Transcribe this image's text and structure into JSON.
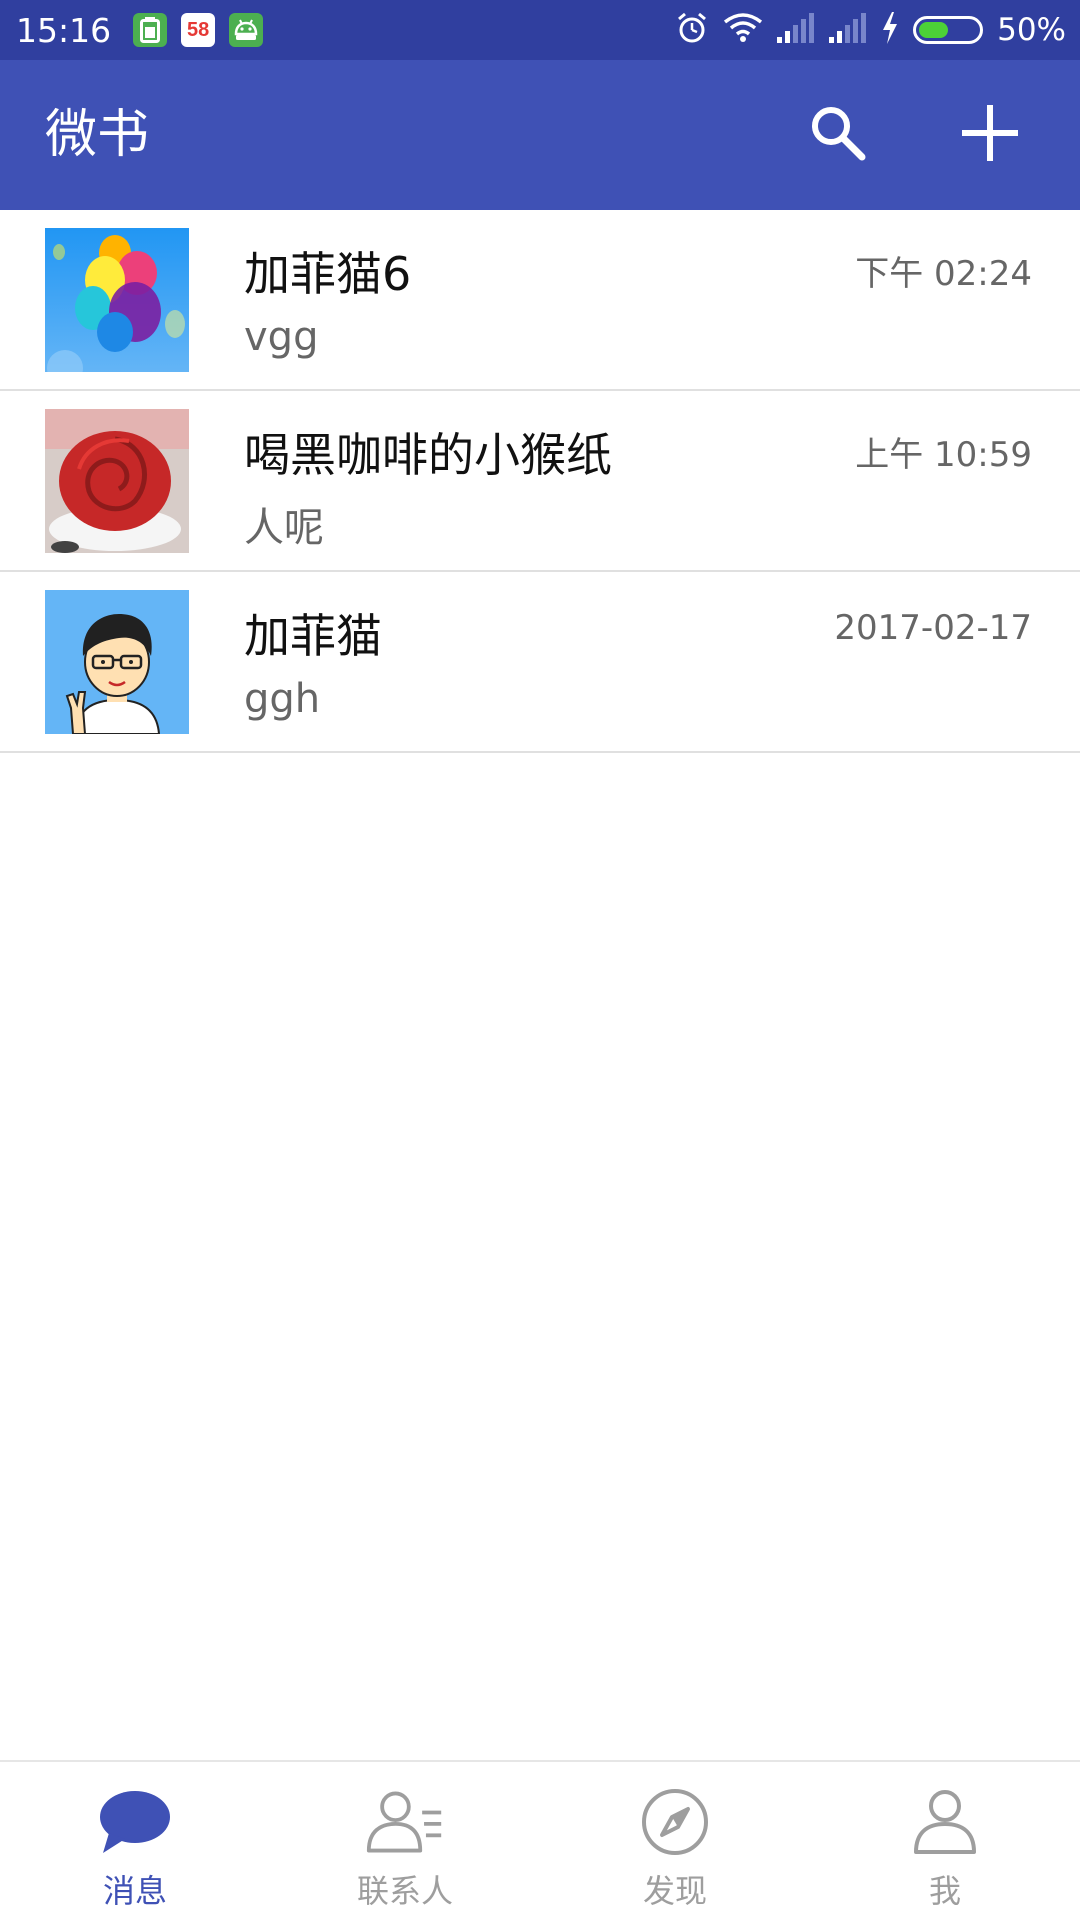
{
  "status_bar": {
    "time": "15:16",
    "battery_percent": "50%",
    "battery_level": 0.5,
    "notification_icons": [
      "battery-app-icon",
      "58-app-icon",
      "android-app-icon"
    ],
    "system_icons": [
      "alarm-icon",
      "wifi-icon",
      "signal-icon",
      "signal-icon",
      "charging-icon",
      "battery-icon"
    ],
    "app_58_label": "58"
  },
  "app_bar": {
    "title": "微书",
    "actions": [
      "search-icon",
      "add-icon"
    ]
  },
  "conversations": [
    {
      "name": "加菲猫6",
      "preview": "vgg",
      "time": "下午 02:24",
      "avatar": "balloons-avatar"
    },
    {
      "name": "喝黑咖啡的小猴纸",
      "preview": "人呢",
      "time": "上午 10:59",
      "avatar": "red-rose-cake-avatar"
    },
    {
      "name": "加菲猫",
      "preview": "ggh",
      "time": "2017-02-17",
      "avatar": "cartoon-man-avatar"
    }
  ],
  "bottom_nav": {
    "items": [
      {
        "label": "消息",
        "icon": "chat-bubble-icon",
        "active": true
      },
      {
        "label": "联系人",
        "icon": "contacts-icon",
        "active": false
      },
      {
        "label": "发现",
        "icon": "compass-icon",
        "active": false
      },
      {
        "label": "我",
        "icon": "person-icon",
        "active": false
      }
    ]
  },
  "colors": {
    "status_bar": "#303f9f",
    "primary": "#3f51b5",
    "inactive_nav": "#9e9e9e",
    "divider": "#e0e0e0"
  }
}
